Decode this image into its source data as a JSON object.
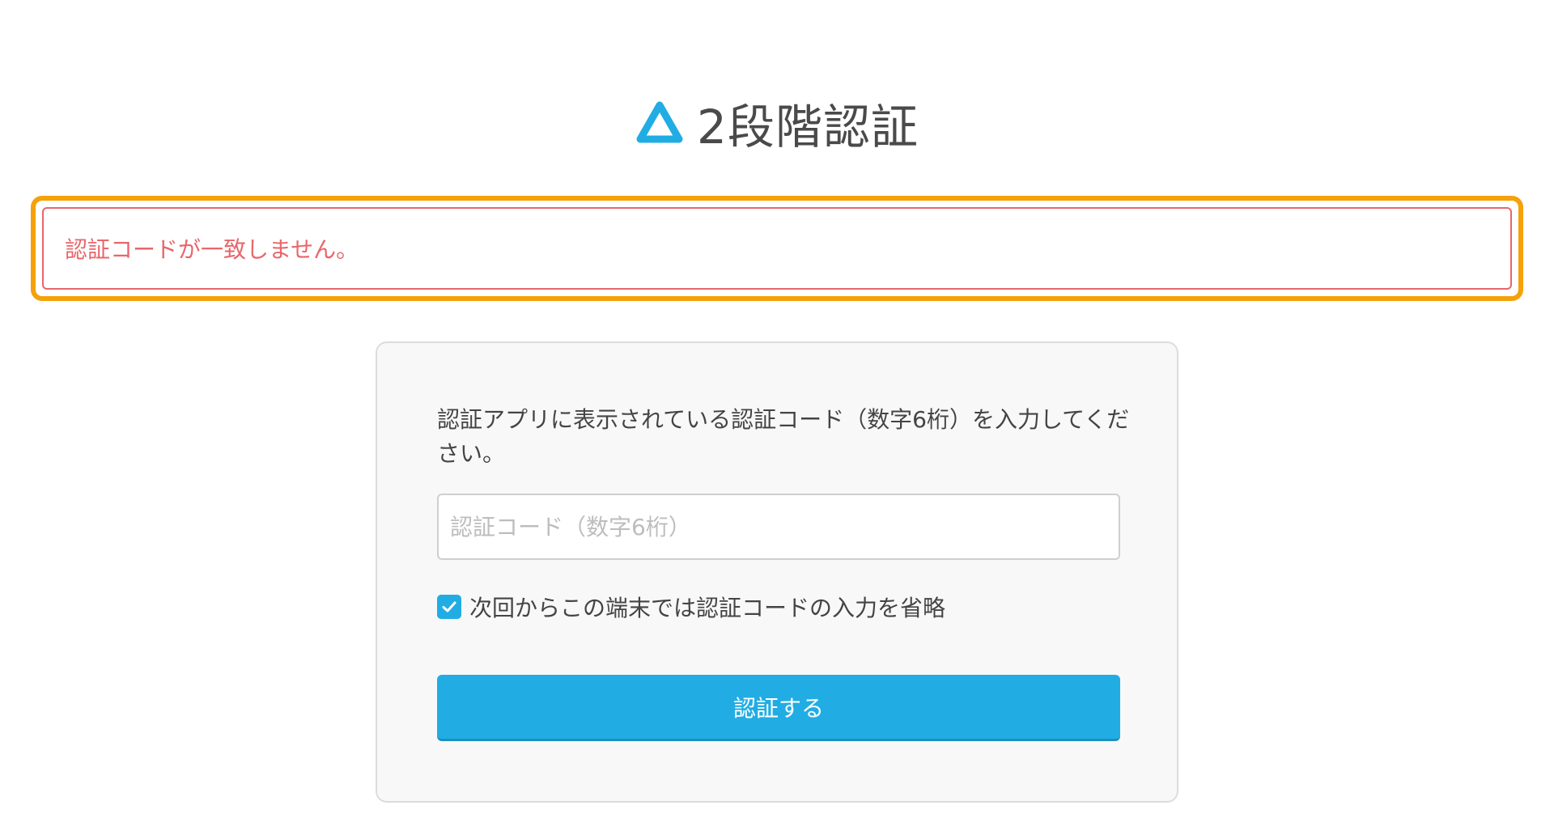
{
  "header": {
    "title": "2段階認証",
    "logo_icon": "delta-triangle-icon",
    "logo_color": "#21ade3"
  },
  "alert": {
    "message": "認証コードが一致しません。",
    "text_color": "#e8666b",
    "highlight_color": "#f5a10a"
  },
  "form": {
    "instruction": "認証アプリに表示されている認証コード（数字6桁）を入力してください。",
    "code_input": {
      "value": "",
      "placeholder": "認証コード（数字6桁）"
    },
    "remember": {
      "checked": true,
      "label": "次回からこの端末では認証コードの入力を省略",
      "icon": "checkmark-icon"
    },
    "submit_label": "認証する",
    "accent_color": "#21ade3"
  }
}
